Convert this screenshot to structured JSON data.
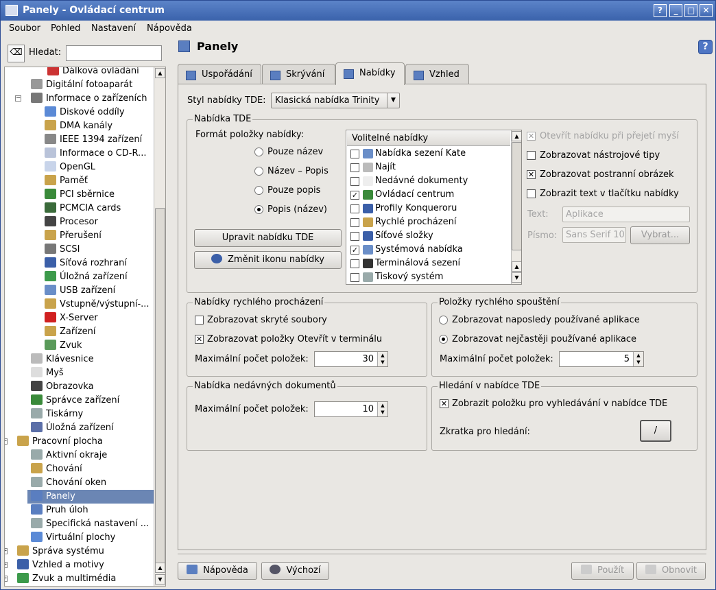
{
  "window": {
    "title": "Panely - Ovládací centrum",
    "btn_help": "?",
    "btn_min": "_",
    "btn_max": "□",
    "btn_close": "✕"
  },
  "menu": [
    "Soubor",
    "Pohled",
    "Nastavení",
    "Nápověda"
  ],
  "search": {
    "label": "Hledat:",
    "value": ""
  },
  "tree": [
    {
      "label": "Dálková ovládání",
      "icon": "remote-icon",
      "color": "#c33"
    },
    {
      "label": "Digitální fotoaparát",
      "icon": "camera-icon",
      "color": "#999"
    },
    {
      "label": "Informace o zařízeních",
      "icon": "info-icon",
      "color": "#777"
    },
    {
      "label": "Diskové oddíly",
      "icon": "disk-icon",
      "color": "#5b8ad6"
    },
    {
      "label": "DMA kanály",
      "icon": "dma-icon",
      "color": "#c9a34b"
    },
    {
      "label": "IEEE 1394 zařízení",
      "icon": "firewire-icon",
      "color": "#888"
    },
    {
      "label": "Informace o CD-R...",
      "icon": "cdrom-icon",
      "color": "#b9c3d9"
    },
    {
      "label": "OpenGL",
      "icon": "opengl-icon",
      "color": "#c8d4ea"
    },
    {
      "label": "Paměť",
      "icon": "memory-icon",
      "color": "#c9a34b"
    },
    {
      "label": "PCI sběrnice",
      "icon": "pci-icon",
      "color": "#3a8a3a"
    },
    {
      "label": "PCMCIA cards",
      "icon": "pcmcia-icon",
      "color": "#3a6a3a"
    },
    {
      "label": "Procesor",
      "icon": "cpu-icon",
      "color": "#444"
    },
    {
      "label": "Přerušení",
      "icon": "interrupt-icon",
      "color": "#c9a34b"
    },
    {
      "label": "SCSI",
      "icon": "scsi-icon",
      "color": "#777"
    },
    {
      "label": "Síťová rozhraní",
      "icon": "network-icon",
      "color": "#3b5fa8"
    },
    {
      "label": "Úložná zařízení",
      "icon": "storage-icon",
      "color": "#3c9a4b"
    },
    {
      "label": "USB zařízení",
      "icon": "usb-icon",
      "color": "#6a8ec8"
    },
    {
      "label": "Vstupně/výstupní-...",
      "icon": "io-icon",
      "color": "#c9a34b"
    },
    {
      "label": "X-Server",
      "icon": "xserver-icon",
      "color": "#d02020"
    },
    {
      "label": "Zařízení",
      "icon": "devices-icon",
      "color": "#c9a34b"
    },
    {
      "label": "Zvuk",
      "icon": "sound-icon",
      "color": "#5a9a5a"
    },
    {
      "label": "Klávesnice",
      "icon": "keyboard-icon",
      "color": "#bbb"
    },
    {
      "label": "Myš",
      "icon": "mouse-icon",
      "color": "#ddd"
    },
    {
      "label": "Obrazovka",
      "icon": "display-icon",
      "color": "#444"
    },
    {
      "label": "Správce zařízení",
      "icon": "device-manager-icon",
      "color": "#3a8a3a"
    },
    {
      "label": "Tiskárny",
      "icon": "printer-icon",
      "color": "#9aa"
    },
    {
      "label": "Úložná zařízení",
      "icon": "storage2-icon",
      "color": "#5b6fa8"
    },
    {
      "label": "Pracovní plocha",
      "icon": "desktop-icon",
      "color": "#c9a34b"
    },
    {
      "label": "Aktivní okraje",
      "icon": "borders-icon",
      "color": "#9aa"
    },
    {
      "label": "Chování",
      "icon": "behavior-icon",
      "color": "#c9a34b"
    },
    {
      "label": "Chování oken",
      "icon": "window-behavior-icon",
      "color": "#9aa"
    },
    {
      "label": "Panely",
      "icon": "panel-icon",
      "color": "#5a7ec0"
    },
    {
      "label": "Pruh úloh",
      "icon": "taskbar-icon",
      "color": "#5a7ec0"
    },
    {
      "label": "Specifická nastavení ...",
      "icon": "specific-icon",
      "color": "#9aa"
    },
    {
      "label": "Virtuální plochy",
      "icon": "virtual-desktops-icon",
      "color": "#5b8ad6"
    },
    {
      "label": "Správa systému",
      "icon": "sysadmin-icon",
      "color": "#c9a34b"
    },
    {
      "label": "Vzhled a motivy",
      "icon": "appearance-icon",
      "color": "#3b5fa8"
    },
    {
      "label": "Zvuk a multimédia",
      "icon": "multimedia-icon",
      "color": "#3c9a4b"
    }
  ],
  "page": {
    "title": "Panely"
  },
  "tabs": [
    "Uspořádání",
    "Skrývání",
    "Nabídky",
    "Vzhled"
  ],
  "style": {
    "label": "Styl nabídky TDE:",
    "value": "Klasická nabídka Trinity"
  },
  "tde_menu": {
    "group": "Nabídka TDE",
    "format_label": "Formát položky nabídky:",
    "radios": [
      "Pouze název",
      "Název – Popis",
      "Pouze popis",
      "Popis (název)"
    ],
    "edit_btn": "Upravit nabídku TDE",
    "icon_btn": "Změnit ikonu nabídky",
    "list_header": "Volitelné nabídky",
    "list": [
      {
        "label": "Nabídka sezení Kate",
        "checked": "",
        "color": "#6a8ec8"
      },
      {
        "label": "Najít",
        "checked": "",
        "color": "#bbb"
      },
      {
        "label": "Nedávné dokumenty",
        "checked": "",
        "color": "#eee"
      },
      {
        "label": "Ovládací centrum",
        "checked": "✓",
        "color": "#3a8a3a"
      },
      {
        "label": "Profily Konqueroru",
        "checked": "",
        "color": "#3b5fa8"
      },
      {
        "label": "Rychlé procházení",
        "checked": "",
        "color": "#c9a34b"
      },
      {
        "label": "Síťové složky",
        "checked": "",
        "color": "#3b5fa8"
      },
      {
        "label": "Systémová nabídka",
        "checked": "✓",
        "color": "#6a8ec8"
      },
      {
        "label": "Terminálová sezení",
        "checked": "",
        "color": "#333"
      },
      {
        "label": "Tiskový systém",
        "checked": "",
        "color": "#9aa"
      }
    ],
    "open_hover": "Otevřít nabídku při přejetí myší",
    "tooltips": "Zobrazovat nástrojové tipy",
    "side_image": "Zobrazovat postranní obrázek",
    "show_text": "Zobrazit text v tlačítku nabídky",
    "text_label": "Text:",
    "text_value": "Aplikace",
    "font_label": "Písmo:",
    "font_value": "Sans Serif 10",
    "choose_btn": "Vybrat..."
  },
  "quick": {
    "group": "Nabídky rychlého procházení",
    "hidden": "Zobrazovat skryté soubory",
    "terminal": "Zobrazovat položky Otevřít v terminálu",
    "max_label": "Maximální počet položek:",
    "max_value": "30"
  },
  "launch": {
    "group": "Položky rychlého spouštění",
    "recent": "Zobrazovat naposledy používané aplikace",
    "frequent": "Zobrazovat nejčastěji používané aplikace",
    "max_label": "Maximální počet položek:",
    "max_value": "5"
  },
  "recent_docs": {
    "group": "Nabídka nedávných dokumentů",
    "max_label": "Maximální počet položek:",
    "max_value": "10"
  },
  "search_menu": {
    "group": "Hledání v nabídce TDE",
    "show": "Zobrazit položku pro vyhledávání v nabídce TDE",
    "shortcut_label": "Zkratka pro hledání:",
    "shortcut_value": "/"
  },
  "footer": {
    "help": "Nápověda",
    "default": "Výchozí",
    "apply": "Použít",
    "reset": "Obnovit"
  }
}
